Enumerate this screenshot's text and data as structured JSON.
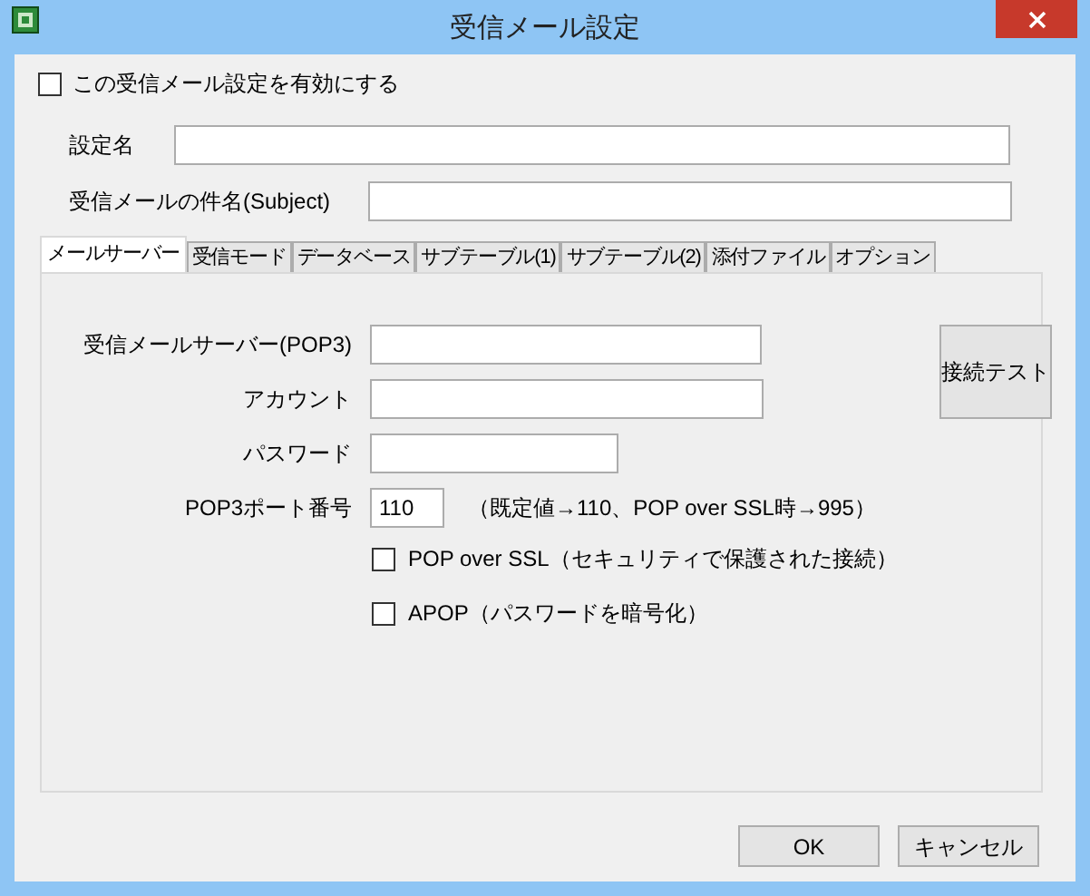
{
  "window": {
    "title": "受信メール設定"
  },
  "enable": {
    "label": "この受信メール設定を有効にする",
    "checked": false
  },
  "fields": [
    {
      "label": "設定名"
    },
    {
      "label": "受信メールの件名(Subject)"
    }
  ],
  "tabs": [
    {
      "label": "メールサーバー",
      "selected": true
    },
    {
      "label": "受信モード",
      "selected": false
    },
    {
      "label": "データベース",
      "selected": false
    },
    {
      "label": "サブテーブル(1)",
      "selected": false
    },
    {
      "label": "サブテーブル(2)",
      "selected": false
    },
    {
      "label": "添付ファイル",
      "selected": false
    },
    {
      "label": "オプション",
      "selected": false
    }
  ],
  "server": {
    "fields": [
      {
        "label": "受信メールサーバー(POP3)"
      },
      {
        "label": "アカウント"
      },
      {
        "label": "パスワード"
      }
    ],
    "port": {
      "label": "POP3ポート番号",
      "value": "110",
      "note": "（既定値→110、POP over SSL時→995）"
    },
    "connect_button": "接続テスト",
    "options": [
      {
        "label": "POP over SSL（セキュリティで保護された接続）",
        "checked": false
      },
      {
        "label": "APOP（パスワードを暗号化）",
        "checked": false
      }
    ]
  },
  "buttons": [
    "OK",
    "キャンセル"
  ]
}
